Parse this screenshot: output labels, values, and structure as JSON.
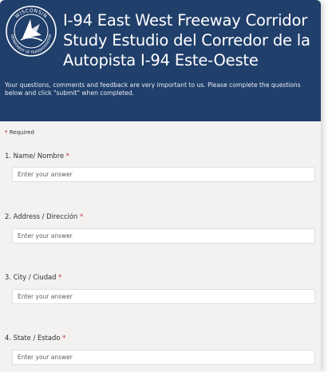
{
  "header": {
    "seal_text_top": "WISCONSIN",
    "seal_text_bottom": "DEPARTMENT OF TRANSPORTATION",
    "title": "I-94 East West Freeway Corridor Study Estudio del Corredor de la Autopista I-94 Este-Oeste",
    "subtitle": "Your questions, comments and feedback are very important to us. Please complete the questions below and click \"submit\" when completed.",
    "colors": {
      "background": "#213f6b",
      "text": "#ffffff"
    }
  },
  "form": {
    "required_star": "*",
    "required_note": "Required",
    "questions": [
      {
        "label": "1. Name/ Nombre",
        "star": "*",
        "placeholder": "Enter your answer"
      },
      {
        "label": "2. Address / Dirección",
        "star": "*",
        "placeholder": "Enter your answer"
      },
      {
        "label": "3. City / Ciudad",
        "star": "*",
        "placeholder": "Enter your answer"
      },
      {
        "label": "4. State / Estado",
        "star": "*",
        "placeholder": "Enter your answer"
      }
    ],
    "colors": {
      "background": "#f3f2f1",
      "required_star": "#c4314b"
    }
  }
}
